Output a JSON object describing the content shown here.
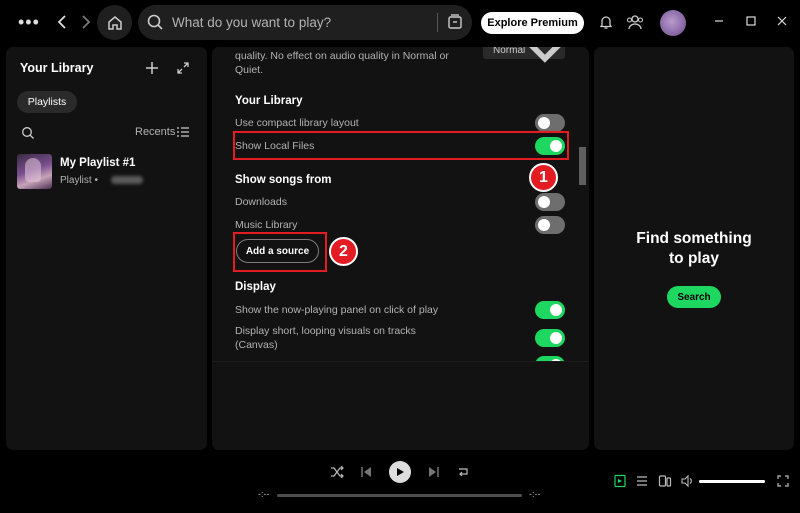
{
  "topbar": {
    "search_placeholder": "What do you want to play?",
    "premium_label": "Explore Premium"
  },
  "library": {
    "title": "Your Library",
    "filter_chip": "Playlists",
    "sort_label": "Recents",
    "items": [
      {
        "title": "My Playlist #1",
        "subtitle": "Playlist •"
      }
    ]
  },
  "settings": {
    "prev_desc": "quality. No effect on audio quality in Normal or Quiet.",
    "prev_select": "Normal",
    "your_library": {
      "heading": "Your Library",
      "compact_label": "Use compact library layout",
      "compact_on": false,
      "local_files_label": "Show Local Files",
      "local_files_on": true
    },
    "show_songs_from": {
      "heading": "Show songs from",
      "sources": [
        {
          "label": "Downloads",
          "on": false
        },
        {
          "label": "Music Library",
          "on": false
        }
      ],
      "add_source_label": "Add a source"
    },
    "display": {
      "heading": "Display",
      "nowplaying_label": "Show the now-playing panel on click of play",
      "nowplaying_on": true,
      "canvas_label": "Display short, looping visuals on tracks (Canvas)",
      "canvas_on": true
    }
  },
  "annotations": {
    "badge1": "1",
    "badge2": "2",
    "highlight_color": "#e31b23"
  },
  "right_panel": {
    "title": "Find something to play",
    "button_label": "Search"
  },
  "player": {
    "time_elapsed": "-:--",
    "time_total": "-:--"
  },
  "colors": {
    "accent": "#1ed760",
    "panel": "#121212",
    "background": "#000000"
  }
}
